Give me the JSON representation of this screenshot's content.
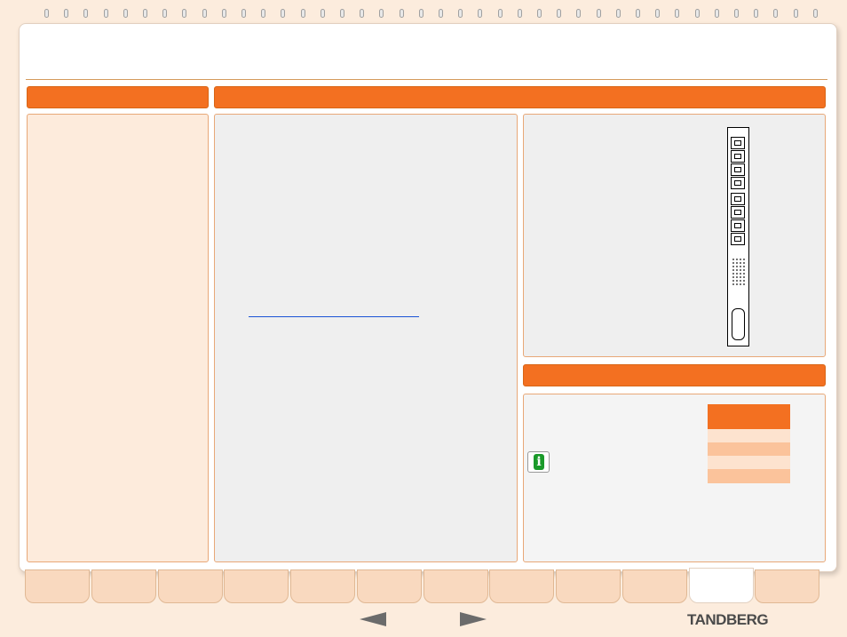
{
  "brand": {
    "logo_text": "TANDBERG"
  },
  "colors": {
    "accent": "#f37021",
    "page_bg": "#fcecdd",
    "legend_dark": "#f37021",
    "legend_light": "#fbc39b",
    "legend_pale": "#fde3cf",
    "link": "#1a53d6",
    "info_green": "#1a9a2a"
  },
  "icons": {
    "info": "info-icon",
    "prev": "arrow-left-icon",
    "next": "arrow-right-icon"
  },
  "info_icon_glyph": "i",
  "tabs": {
    "count": 12,
    "active_index": 10
  }
}
